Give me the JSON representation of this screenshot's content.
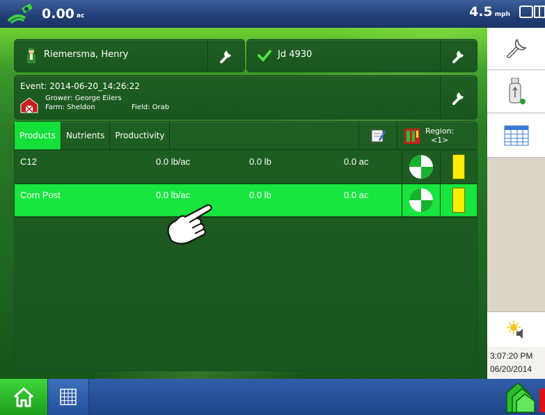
{
  "topbar": {
    "area_value": "0.00",
    "area_unit": "ac",
    "speed_value": "4.5",
    "speed_unit": "mph",
    "gps_icon": "gps-satellite-icon",
    "display_icon": "display-toggle-icon"
  },
  "operator": {
    "name": "Riemersma, Henry",
    "icon": "operator-icon"
  },
  "vehicle": {
    "name": "Jd 4930",
    "icon": "check-icon"
  },
  "event": {
    "title": "Event: 2014-06-20_14:26:22",
    "grower": "Grower: George Eilers",
    "farm": "Farm: Sheldon",
    "field": "Field: Orab"
  },
  "tabs": [
    {
      "label": "Products",
      "active": true
    },
    {
      "label": "Nutrients",
      "active": false
    },
    {
      "label": "Productivity",
      "active": false
    }
  ],
  "region": {
    "label": "Region:",
    "value": "<1>"
  },
  "products": [
    {
      "name": "C12",
      "rate": "0.0 lb/ac",
      "total": "0.0 lb",
      "area": "0.0 ac",
      "color": "#ffee00",
      "selected": false
    },
    {
      "name": "Corn Post",
      "rate": "0.0 lb/ac",
      "total": "0.0 lb",
      "area": "0.0 ac",
      "color": "#ffee00",
      "selected": true
    }
  ],
  "sidebar": {
    "time": "3:07:20 PM",
    "date": "06/20/2014"
  },
  "colors": {
    "accent_green": "#17e63e",
    "topbar_blue": "#213e75",
    "swatch_yellow": "#ffee00"
  }
}
